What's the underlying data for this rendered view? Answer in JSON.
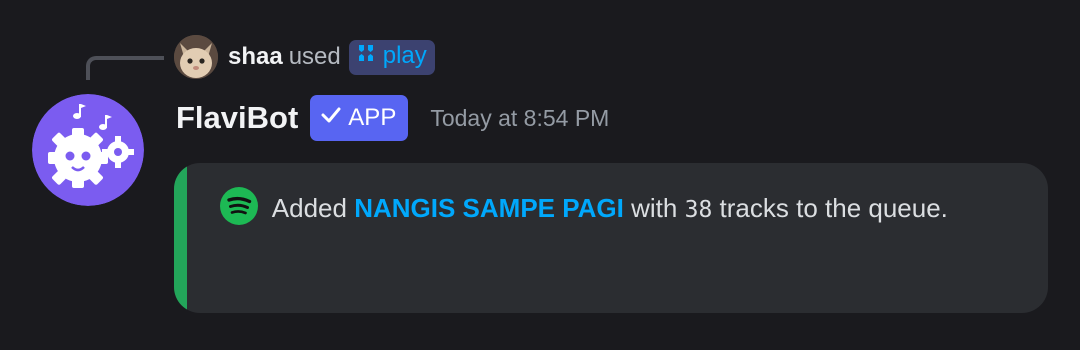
{
  "reply": {
    "username": "shaa",
    "used_text": "used",
    "command": "play"
  },
  "message": {
    "author": "FlaviBot",
    "badge": "APP",
    "timestamp": "Today at 8:54 PM"
  },
  "embed": {
    "accent_color": "#23a55a",
    "icon": "spotify-icon",
    "prefix": "Added",
    "playlist": "NANGIS SAMPE PAGI",
    "middle": "with",
    "count": "38",
    "suffix": "tracks to the queue."
  },
  "colors": {
    "background": "#1a1a1e",
    "embed_background": "#2b2d31",
    "link": "#00a8fc",
    "app_badge": "#5865f2",
    "bot_avatar": "#7b5cf0"
  }
}
